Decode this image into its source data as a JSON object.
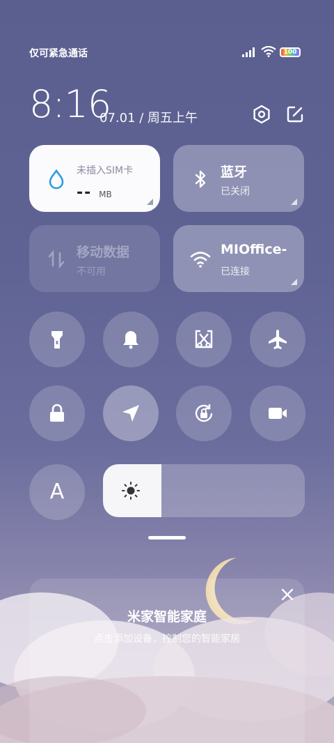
{
  "status_bar": {
    "carrier_text": "仅可紧急通话",
    "battery_label": "100"
  },
  "clock": {
    "time": "8:16",
    "date": "07.01 / 周五上午"
  },
  "tiles": {
    "data": {
      "title": "未插入SIM卡",
      "value": "--",
      "unit": "MB"
    },
    "bluetooth": {
      "title": "蓝牙",
      "status": "已关闭"
    },
    "mobile_data": {
      "title": "移动数据",
      "status": "不可用"
    },
    "wifi": {
      "title": "MIOffice-",
      "status": "已连接"
    }
  },
  "toggles": [
    {
      "name": "flashlight-icon",
      "on": false
    },
    {
      "name": "bell-icon",
      "on": false
    },
    {
      "name": "screenshot-icon",
      "on": false
    },
    {
      "name": "airplane-icon",
      "on": false
    },
    {
      "name": "lock-icon",
      "on": false
    },
    {
      "name": "location-icon",
      "on": true
    },
    {
      "name": "rotation-lock-icon",
      "on": false
    },
    {
      "name": "video-icon",
      "on": false
    }
  ],
  "brightness": {
    "auto_label": "A",
    "level": 0.29
  },
  "smart_home": {
    "title": "米家智能家庭",
    "subtitle": "点击添加设备，控制您的智能家居"
  },
  "colors": {
    "tile_active": "#fbfbfd",
    "accent": "#2d9cdb"
  }
}
